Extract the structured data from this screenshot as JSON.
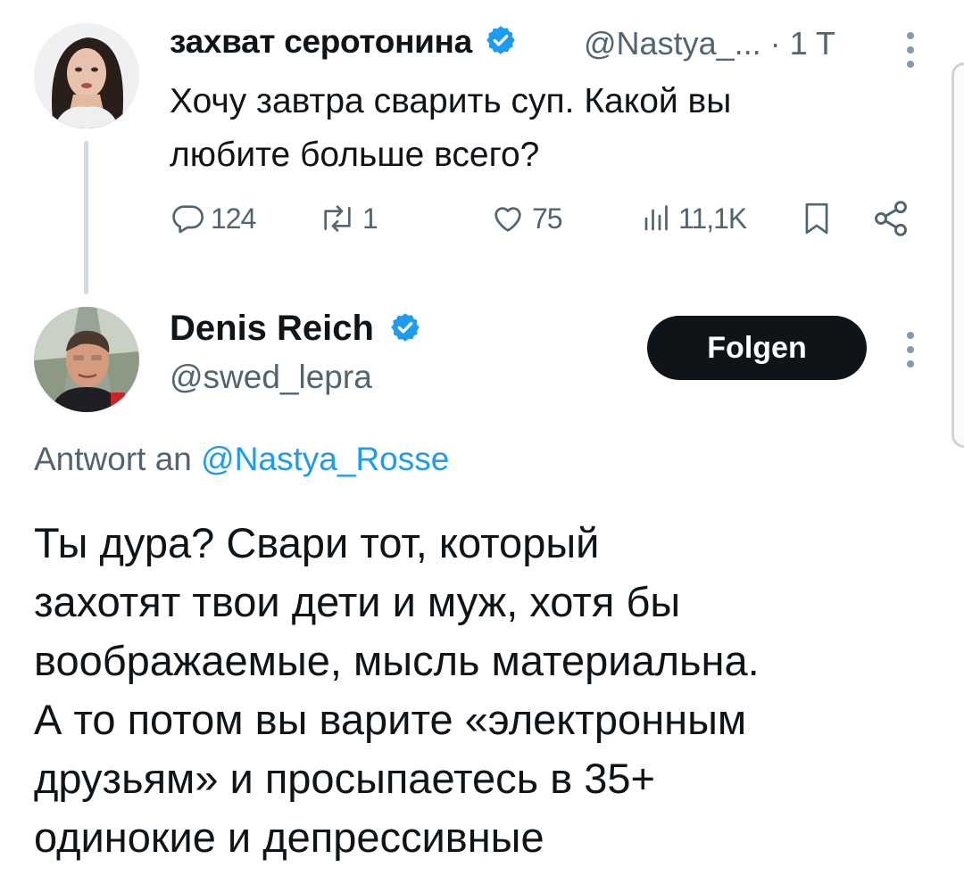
{
  "first_tweet": {
    "author_name": "захват серотонина",
    "handle_and_time": "@Nastya_... · 1 T",
    "text_line1": "Хочу завтра сварить суп. Какой вы",
    "text_line2": "любите больше всего?",
    "actions": {
      "replies": "124",
      "retweets": "1",
      "likes": "75",
      "views": "11,1K"
    },
    "icons": [
      "reply-icon",
      "retweet-icon",
      "like-icon",
      "views-icon",
      "bookmark-icon",
      "share-icon",
      "verified-badge-icon",
      "more-icon"
    ]
  },
  "second_tweet": {
    "author_name": "Denis Reich",
    "handle": "@swed_lepra",
    "follow_label": "Folgen",
    "reply_prefix": "Antwort an",
    "reply_mention": "@Nastya_Rosse",
    "text_lines": [
      "Ты дура? Свари тот, который",
      "захотят твои дети и муж, хотя бы",
      "воображаемые, мысль материальна.",
      "А то потом вы варите «электронным",
      "друзьям» и просыпаетесь в 35+",
      "одинокие и депрессивные"
    ]
  },
  "colors": {
    "verified": "#1d9bf0",
    "text": "#0f1419",
    "secondary": "#536471",
    "link": "#1d9bf0",
    "button_bg": "#0f1419"
  }
}
